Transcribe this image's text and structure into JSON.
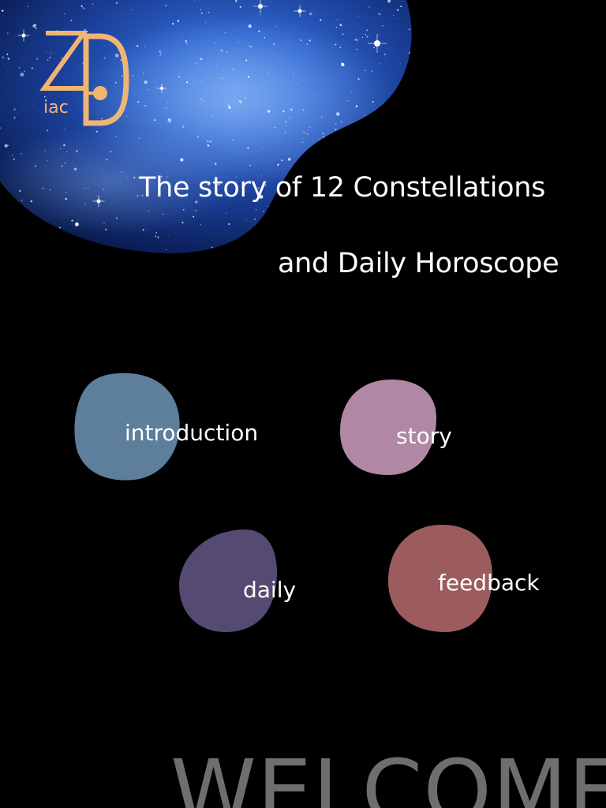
{
  "logo": {
    "letters": "ZD",
    "suffix": "iac",
    "color": "#f0b573"
  },
  "header": {
    "title_line_1": "The story of 12 Constellations",
    "title_line_2": "and Daily Horoscope"
  },
  "nav": {
    "introduction": {
      "label": "introduction",
      "color": "#5e7f9c"
    },
    "story": {
      "label": "story",
      "color": "#b088a4"
    },
    "daily": {
      "label": "daily",
      "color": "#554a72"
    },
    "feedback": {
      "label": "feedback",
      "color": "#9c5c5e"
    }
  },
  "welcome": {
    "text": "WELCOME"
  }
}
